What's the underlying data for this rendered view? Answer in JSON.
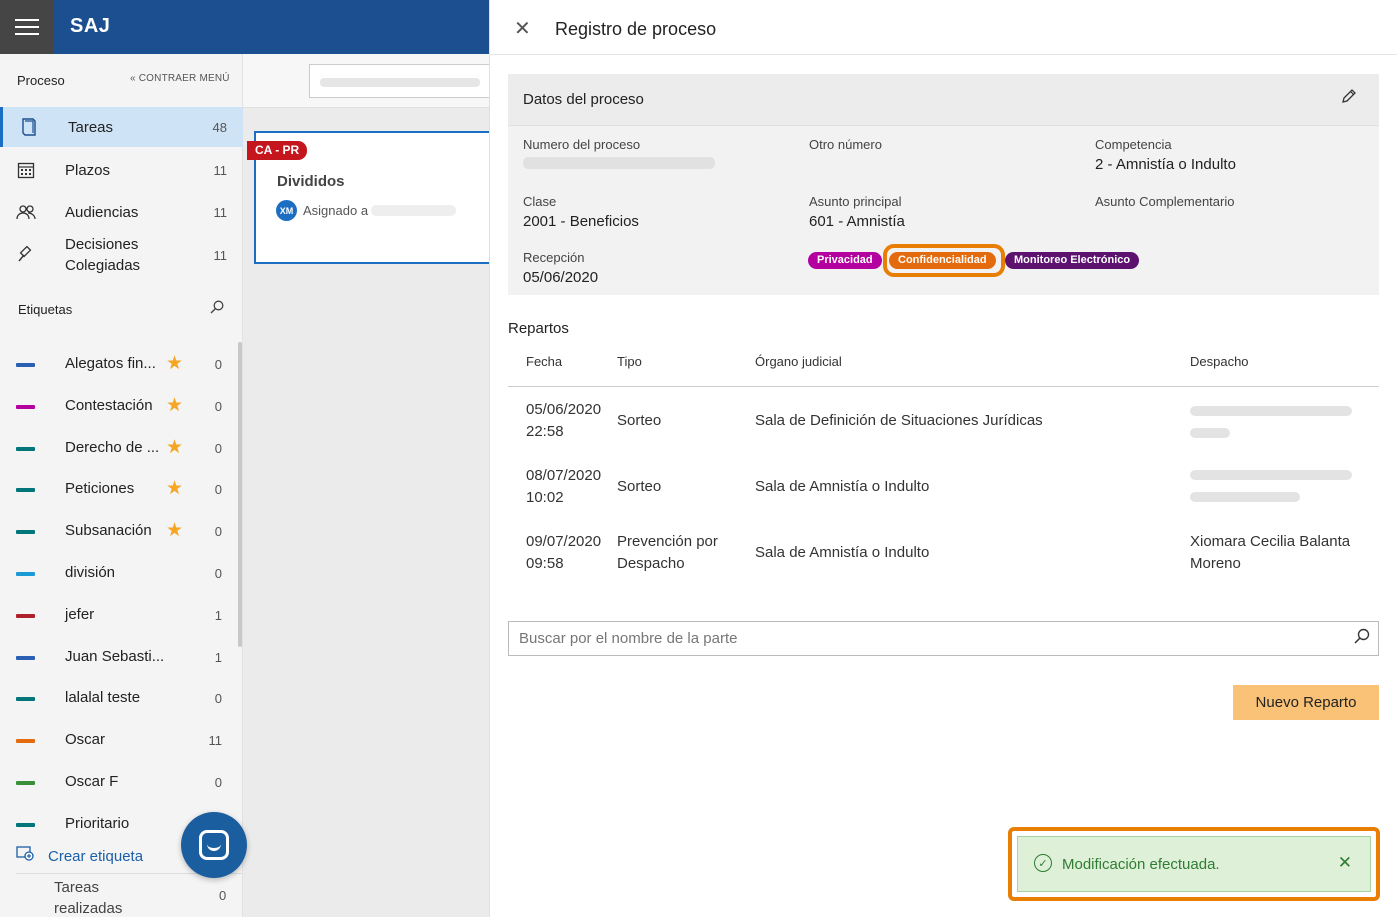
{
  "app": {
    "brand": "SAJ"
  },
  "sidebar": {
    "heading": "Proceso",
    "collapse_label": "CONTRAER MENÚ",
    "nav": [
      {
        "label": "Tareas",
        "count": "48",
        "icon": "book-icon"
      },
      {
        "label": "Plazos",
        "count": "11",
        "icon": "calendar-icon"
      },
      {
        "label": "Audiencias",
        "count": "11",
        "icon": "people-icon"
      },
      {
        "label": "Decisiones Colegiadas",
        "count": "11",
        "icon": "gavel-icon"
      }
    ],
    "tags_heading": "Etiquetas",
    "tags": [
      {
        "label": "Alegatos fin...",
        "count": "0",
        "color": "#2b5fb4",
        "starred": true
      },
      {
        "label": "Contestación",
        "count": "0",
        "color": "#b4009e",
        "starred": true
      },
      {
        "label": "Derecho de ...",
        "count": "0",
        "color": "#00757a",
        "starred": true
      },
      {
        "label": "Peticiones",
        "count": "0",
        "color": "#00757a",
        "starred": true
      },
      {
        "label": "Subsanación",
        "count": "0",
        "color": "#00757a",
        "starred": true
      },
      {
        "label": "división",
        "count": "0",
        "color": "#1a9ad6",
        "starred": false
      },
      {
        "label": "jefer",
        "count": "1",
        "color": "#b0202a",
        "starred": false
      },
      {
        "label": "Juan Sebasti...",
        "count": "1",
        "color": "#2b5fb4",
        "starred": false
      },
      {
        "label": "lalalal teste",
        "count": "0",
        "color": "#00757a",
        "starred": false
      },
      {
        "label": "Oscar",
        "count": "11",
        "color": "#e46a0e",
        "starred": false
      },
      {
        "label": "Oscar F",
        "count": "0",
        "color": "#3a8f3a",
        "starred": false
      },
      {
        "label": "Prioritario",
        "count": "",
        "color": "#00757a",
        "starred": false
      }
    ],
    "create_tag": "Crear etiqueta",
    "done_tasks": "Tareas realizadas",
    "done_tasks_count": "0"
  },
  "card": {
    "badge": "CA - PR",
    "title": "Divididos",
    "avatar": "XM",
    "assigned": "Asignado a"
  },
  "panel": {
    "title": "Registro de proceso",
    "datos": {
      "title": "Datos del proceso",
      "numero_label": "Numero del proceso",
      "otro_label": "Otro número",
      "competencia_label": "Competencia",
      "competencia_value": "2 - Amnistía o Indulto",
      "clase_label": "Clase",
      "clase_value": "2001 - Beneficios",
      "asunto_label": "Asunto principal",
      "asunto_value": "601 - Amnistía",
      "complementario_label": "Asunto Complementario",
      "recepcion_label": "Recepción",
      "recepcion_value": "05/06/2020",
      "pills": [
        {
          "label": "Privacidad",
          "color": "#b4009e"
        },
        {
          "label": "Confidencialidad",
          "color": "#e46a0e"
        },
        {
          "label": "Monitoreo Electrónico",
          "color": "#5c126e"
        }
      ]
    },
    "repartos": {
      "title": "Repartos",
      "headers": [
        "Fecha",
        "Tipo",
        "Órgano judicial",
        "Despacho"
      ],
      "rows": [
        {
          "fecha1": "05/06/2020",
          "fecha2": "22:58",
          "tipo1": "Sorteo",
          "tipo2": "",
          "organo": "Sala de Definición de Situaciones Jurídicas",
          "despacho1": "",
          "despacho2": ""
        },
        {
          "fecha1": "08/07/2020",
          "fecha2": "10:02",
          "tipo1": "Sorteo",
          "tipo2": "",
          "organo": "Sala de Amnistía o Indulto",
          "despacho1": "",
          "despacho2": ""
        },
        {
          "fecha1": "09/07/2020",
          "fecha2": "09:58",
          "tipo1": "Prevención por",
          "tipo2": "Despacho",
          "organo": "Sala de Amnistía o Indulto",
          "despacho1": "Xiomara Cecilia Balanta",
          "despacho2": "Moreno"
        }
      ]
    },
    "search_placeholder": "Buscar por el nombre de la parte",
    "new_button": "Nuevo Reparto"
  },
  "toast": {
    "message": "Modificación efectuada."
  }
}
